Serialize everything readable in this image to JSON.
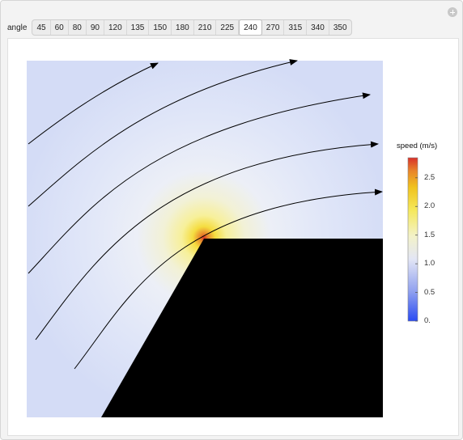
{
  "controls": {
    "label": "angle",
    "options": [
      "45",
      "60",
      "80",
      "90",
      "120",
      "135",
      "150",
      "180",
      "210",
      "225",
      "240",
      "270",
      "315",
      "340",
      "350"
    ],
    "selected": "240"
  },
  "legend": {
    "title": "speed (m/s)",
    "ticks": [
      "2.5",
      "2.0",
      "1.5",
      "1.0",
      "0.5",
      "0."
    ],
    "tick_values": [
      2.5,
      2.0,
      1.5,
      1.0,
      0.5,
      0.0
    ],
    "range": [
      0,
      2.85
    ],
    "colormap": [
      "#2a4bf2",
      "#8fa0ef",
      "#e3e6f5",
      "#f3f2c8",
      "#f5e85a",
      "#f0c21e",
      "#e8842a",
      "#d8302a"
    ]
  },
  "icons": {
    "add": "plus-icon"
  },
  "colors": {
    "obstacle": "#000000",
    "streamline": "#000000",
    "background_flow": "#dbe2f7",
    "hotspot": "#d8302a"
  }
}
